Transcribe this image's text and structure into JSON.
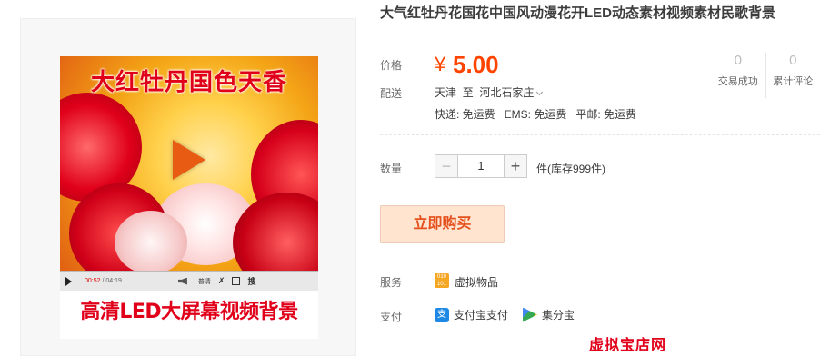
{
  "product": {
    "title": "大气红牡丹花国花中国风动漫花开LED动态素材视频素材民歌背景",
    "poster_title": "大红牡丹国色天香",
    "banner_text": "高清LED大屏幕视频背景",
    "player": {
      "current_time": "00:52",
      "total_time": "/ 04:19",
      "quality_label": "普清",
      "settings_glyph": "✗",
      "search_label": "搜"
    }
  },
  "price": {
    "label": "价格",
    "currency": "¥",
    "value": "5.00"
  },
  "stats": [
    {
      "num": "0",
      "caption": "交易成功"
    },
    {
      "num": "0",
      "caption": "累计评论"
    }
  ],
  "shipping": {
    "label": "配送",
    "from": "天津",
    "to_word": "至",
    "destination": "河北石家庄",
    "fees": [
      "快递: 免运费",
      "EMS: 免运费",
      "平邮: 免运费"
    ]
  },
  "quantity": {
    "label": "数量",
    "minus": "−",
    "value": "1",
    "plus": "+",
    "stock": "件(库存999件)"
  },
  "buy_button": "立即购买",
  "service": {
    "label": "服务",
    "icon_text": "010 101",
    "text": "虚拟物品"
  },
  "payment": {
    "label": "支付",
    "alipay_icon": "支",
    "alipay": "支付宝支付",
    "jifenbao": "集分宝"
  },
  "shop_link": "虚拟宝店网",
  "colors": {
    "price": "#ff4400",
    "buy_bg": "#ffe4d0",
    "buy_text": "#e5511d",
    "banner_red": "#e1001a"
  }
}
